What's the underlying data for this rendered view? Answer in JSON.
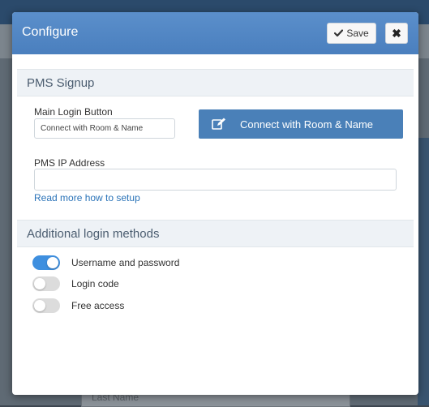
{
  "background": {
    "field_placeholder": "Last Name"
  },
  "modal": {
    "title": "Configure",
    "save_label": "Save",
    "close_label": "✖"
  },
  "pms_signup": {
    "heading": "PMS Signup",
    "main_login_label": "Main Login Button",
    "main_login_value": "Connect with Room & Name",
    "connect_button_label": "Connect with Room & Name",
    "ip_label": "PMS IP Address",
    "ip_value": "",
    "help_link": "Read more how to setup"
  },
  "additional_methods": {
    "heading": "Additional login methods",
    "items": [
      {
        "label": "Username and password",
        "enabled": true
      },
      {
        "label": "Login code",
        "enabled": false
      },
      {
        "label": "Free access",
        "enabled": false
      }
    ]
  },
  "colors": {
    "header": "#4a7fbe",
    "accent": "#4a80b8",
    "toggle_on": "#3e8fdf",
    "toggle_off": "#dcdcdc"
  }
}
